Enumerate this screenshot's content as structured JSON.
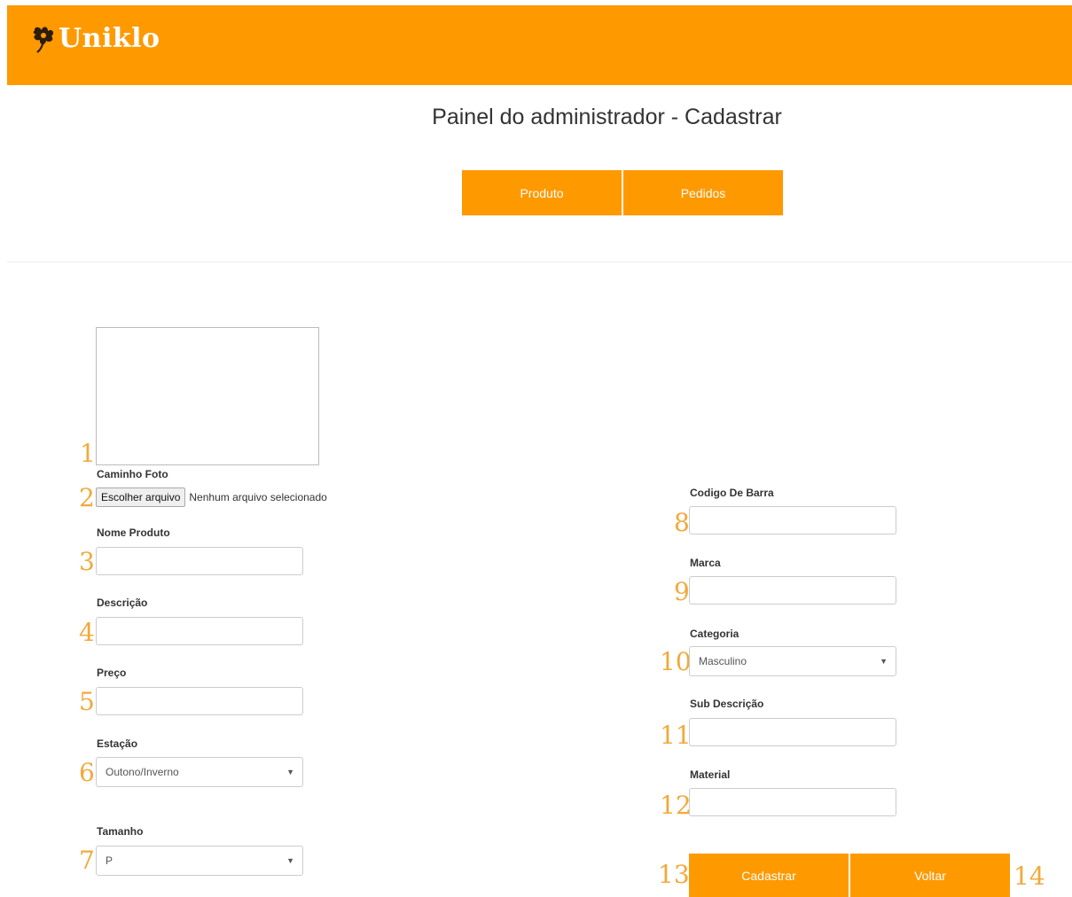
{
  "header": {
    "brand": "Uniklo",
    "color": "#ff9900"
  },
  "page": {
    "title": "Painel do administrador - Cadastrar"
  },
  "nav": {
    "produto": "Produto",
    "pedidos": "Pedidos"
  },
  "form": {
    "caminho_foto": {
      "number": "1",
      "label": "Caminho Foto"
    },
    "file": {
      "number": "2",
      "button": "Escolher arquivo",
      "status": "Nenhum arquivo selecionado"
    },
    "nome_produto": {
      "number": "3",
      "label": "Nome Produto",
      "value": ""
    },
    "descricao": {
      "number": "4",
      "label": "Descrição",
      "value": ""
    },
    "preco": {
      "number": "5",
      "label": "Preço",
      "value": ""
    },
    "estacao": {
      "number": "6",
      "label": "Estação",
      "selected": "Outono/Inverno"
    },
    "tamanho": {
      "number": "7",
      "label": "Tamanho",
      "selected": "P"
    },
    "codigo_barra": {
      "number": "8",
      "label": "Codigo De Barra",
      "value": ""
    },
    "marca": {
      "number": "9",
      "label": "Marca",
      "value": ""
    },
    "categoria": {
      "number": "10",
      "label": "Categoria",
      "selected": "Masculino"
    },
    "sub_descricao": {
      "number": "11",
      "label": "Sub Descrição",
      "value": ""
    },
    "material": {
      "number": "12",
      "label": "Material",
      "value": ""
    }
  },
  "actions": {
    "cadastrar": {
      "number": "13",
      "label": "Cadastrar"
    },
    "voltar": {
      "number": "14",
      "label": "Voltar"
    }
  }
}
